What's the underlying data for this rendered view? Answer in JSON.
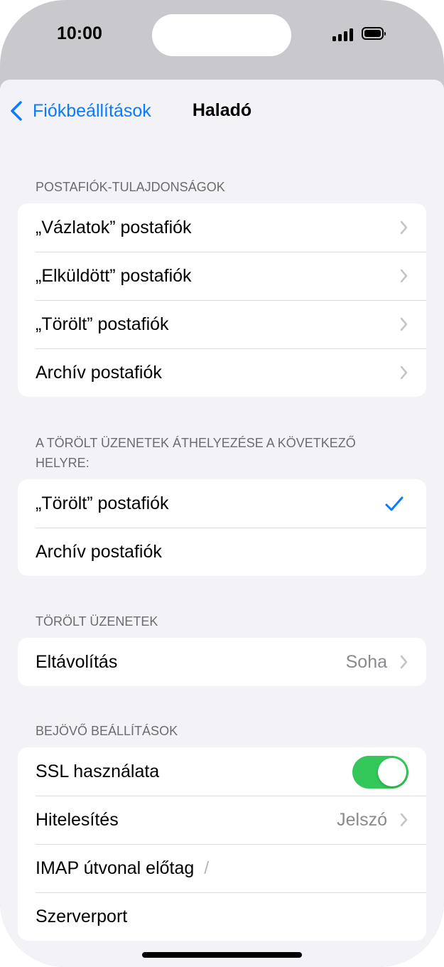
{
  "status": {
    "time": "10:00"
  },
  "nav": {
    "back_label": "Fiókbeállítások",
    "title": "Haladó"
  },
  "sections": {
    "mailbox_props": {
      "header": "POSTAFIÓK-TULAJDONSÁGOK",
      "rows": [
        "„Vázlatok” postafiók",
        "„Elküldött” postafiók",
        "„Törölt” postafiók",
        "Archív postafiók"
      ]
    },
    "move_deleted": {
      "header": "A TÖRÖLT ÜZENETEK ÁTHELYEZÉSE A KÖVETKEZŐ HELYRE:",
      "rows": [
        "„Törölt” postafiók",
        "Archív postafiók"
      ],
      "selected_index": 0
    },
    "deleted_messages": {
      "header": "TÖRÖLT ÜZENETEK",
      "remove_label": "Eltávolítás",
      "remove_value": "Soha"
    },
    "incoming": {
      "header": "BEJÖVŐ BEÁLLÍTÁSOK",
      "ssl_label": "SSL használata",
      "ssl_on": true,
      "auth_label": "Hitelesítés",
      "auth_value": "Jelszó",
      "imap_label": "IMAP útvonal előtag",
      "imap_value": "/",
      "port_label": "Szerverport"
    }
  },
  "colors": {
    "accent": "#0a7aff",
    "toggle_on": "#34c759",
    "background": "#f2f2f7"
  }
}
